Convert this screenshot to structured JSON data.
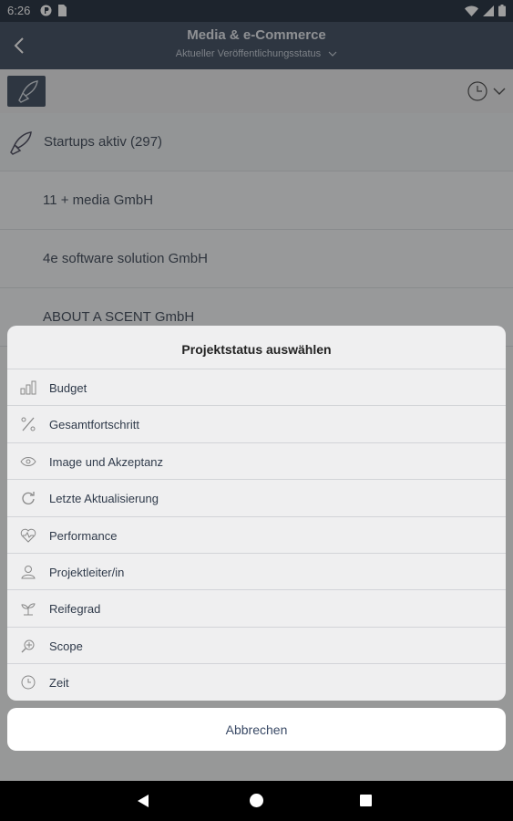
{
  "status_bar": {
    "time": "6:26"
  },
  "header": {
    "title": "Media & e-Commerce",
    "subtitle": "Aktueller Veröffentlichungsstatus"
  },
  "list": {
    "startups_label": "Startups aktiv (297)",
    "rows": [
      "11 + media GmbH",
      "4e software solution GmbH",
      "ABOUT A SCENT GmbH"
    ]
  },
  "sheet": {
    "title": "Projektstatus auswählen",
    "items": [
      {
        "label": "Budget",
        "icon": "budget-icon"
      },
      {
        "label": "Gesamtfortschritt",
        "icon": "percent-icon"
      },
      {
        "label": "Image und Akzeptanz",
        "icon": "eye-icon"
      },
      {
        "label": "Letzte Aktualisierung",
        "icon": "refresh-icon"
      },
      {
        "label": "Performance",
        "icon": "heart-pulse-icon"
      },
      {
        "label": "Projektleiter/in",
        "icon": "person-icon"
      },
      {
        "label": "Reifegrad",
        "icon": "plant-icon"
      },
      {
        "label": "Scope",
        "icon": "scope-icon"
      },
      {
        "label": "Zeit",
        "icon": "clock-icon"
      }
    ],
    "cancel_label": "Abbrechen"
  },
  "colors": {
    "header_bg": "#4b5769",
    "status_bg": "#2f3a4a",
    "sheet_bg": "#efeff0",
    "cancel_text": "#3a4a66"
  }
}
